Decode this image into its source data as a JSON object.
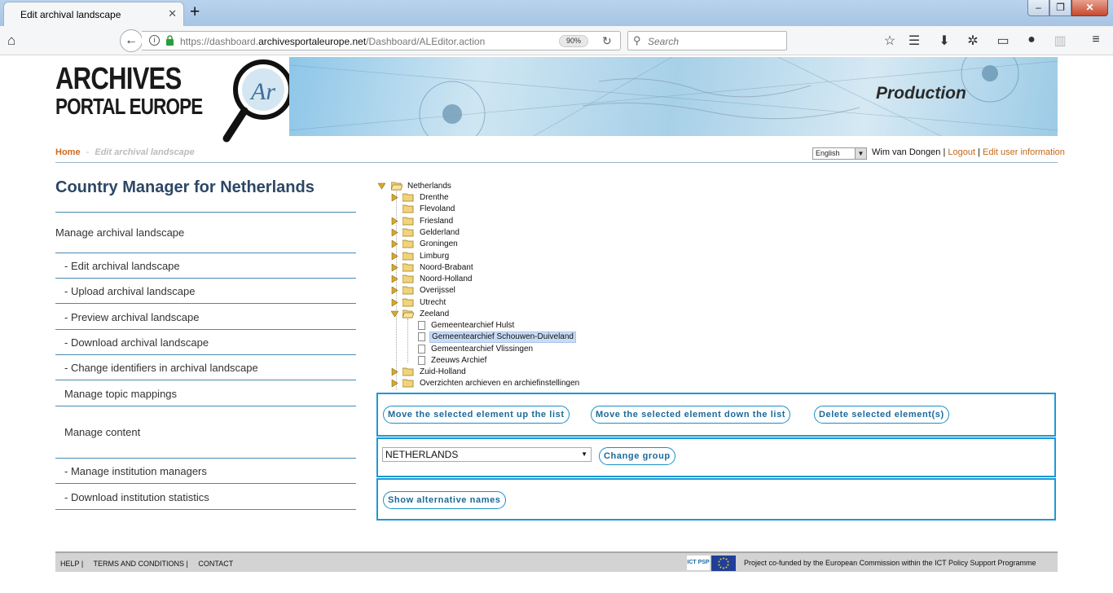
{
  "browser": {
    "tab_title": "Edit archival landscape",
    "url_prefix": "https://dashboard.",
    "url_domain": "archivesportaleurope.net",
    "url_path": "/Dashboard/ALEditor.action",
    "zoom": "90%",
    "search_placeholder": "Search"
  },
  "header": {
    "logo_line1": "ARCHIVES",
    "logo_line2": "PORTAL EUROPE",
    "environment": "Production"
  },
  "breadcrumb": {
    "home": "Home",
    "separator": "-",
    "current": "Edit archival landscape"
  },
  "userbar": {
    "language": "English",
    "user": "Wim van Dongen",
    "sep": "|",
    "logout": "Logout",
    "edit_user": "Edit user information"
  },
  "menu": {
    "title": "Country Manager for Netherlands",
    "manage_al": "Manage archival landscape",
    "edit_al": "- Edit archival landscape",
    "upload_al": "- Upload archival landscape",
    "preview_al": "- Preview archival landscape",
    "download_al": "- Download archival landscape",
    "change_ids": "- Change identifiers in archival landscape",
    "topic_mappings": "Manage topic mappings",
    "manage_content": "Manage content",
    "institution_managers": "- Manage institution managers",
    "institution_stats": "- Download institution statistics"
  },
  "tree": {
    "root": "Netherlands",
    "children": [
      "Drenthe",
      "Flevoland",
      "Friesland",
      "Gelderland",
      "Groningen",
      "Limburg",
      "Noord-Brabant",
      "Noord-Holland",
      "Overijssel",
      "Utrecht",
      "Zeeland"
    ],
    "zeeland_children": [
      "Gemeentearchief Hulst",
      "Gemeentearchief Schouwen-Duiveland",
      "Gemeentearchief Vlissingen",
      "Zeeuws Archief"
    ],
    "after": [
      "Zuid-Holland",
      "Overzichten archieven en archiefinstellingen"
    ]
  },
  "actions": {
    "move_up": "Move the selected element up the list",
    "move_down": "Move the selected element down the list",
    "delete": "Delete selected element(s)",
    "group_value": "NETHERLANDS",
    "change_group": "Change group",
    "show_alt_names": "Show alternative names"
  },
  "footer": {
    "help": "HELP |",
    "terms": "TERMS AND CONDITIONS |",
    "contact": "CONTACT",
    "ict_logo": "ICT PSP",
    "note": "Project co-funded by the European Commission within the ICT Policy Support Programme"
  },
  "colors": {
    "accent_blue": "#1b9ad6",
    "link_orange": "#c26a17",
    "menu_title": "#2c4766"
  }
}
